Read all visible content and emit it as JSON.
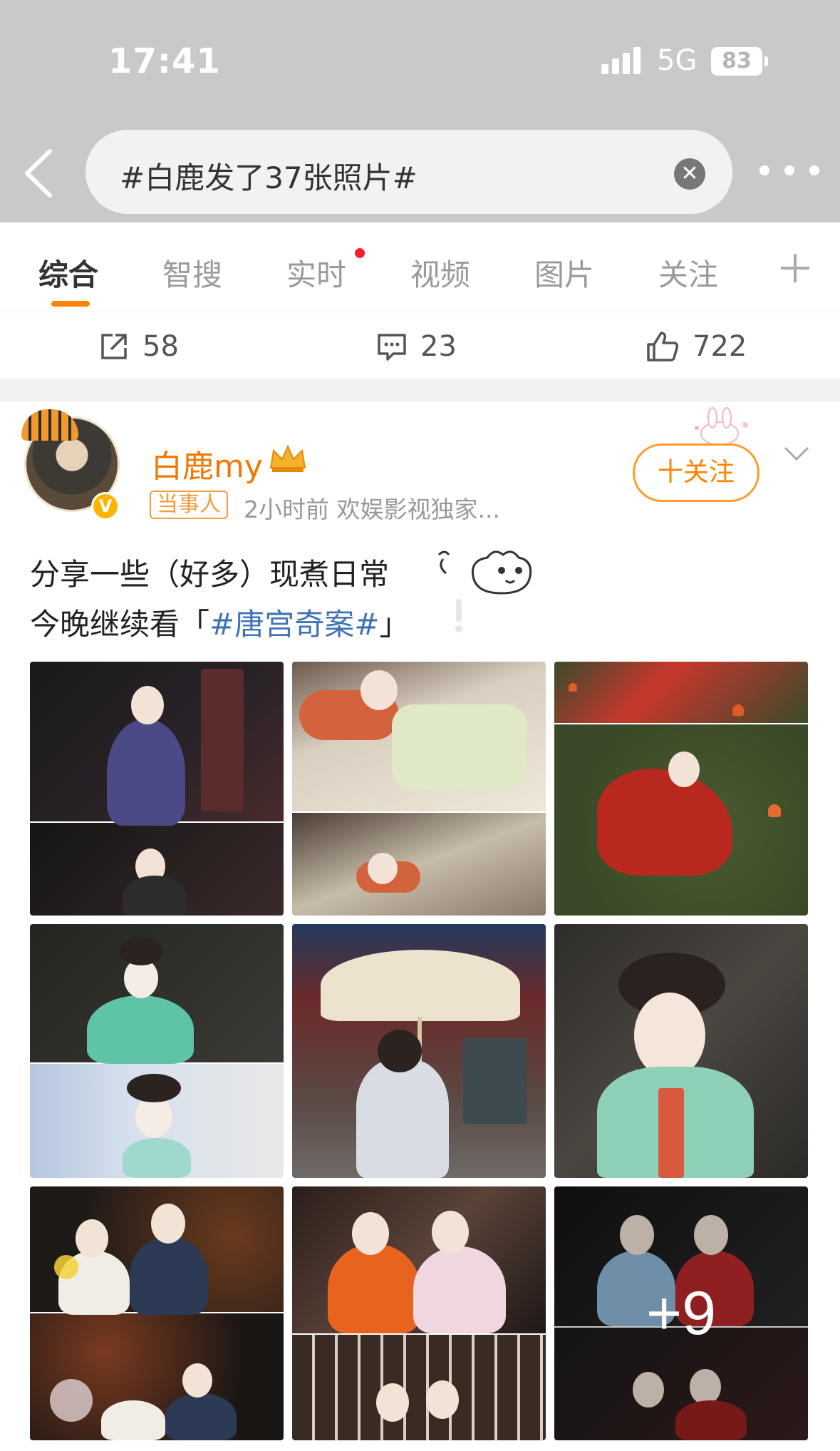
{
  "status_bar": {
    "time": "17:41",
    "network": "5G",
    "battery": "83"
  },
  "search": {
    "query": "#白鹿发了37张照片#",
    "clear_icon": "close-circle-icon",
    "more_icon": "more-dots-icon"
  },
  "tabs": [
    {
      "label": "综合",
      "active": true
    },
    {
      "label": "智搜",
      "active": false
    },
    {
      "label": "实时",
      "active": false,
      "dot": true
    },
    {
      "label": "视频",
      "active": false
    },
    {
      "label": "图片",
      "active": false
    },
    {
      "label": "关注",
      "active": false
    }
  ],
  "actions": {
    "repost": "58",
    "comment": "23",
    "like": "722"
  },
  "post": {
    "user_name": "白鹿my",
    "tag": "当事人",
    "meta": "2小时前  欢娱影视独家...",
    "follow_label": "十关注",
    "line1": "分享一些（好多）现煮日常",
    "line2_prefix": "今晚继续看「",
    "line2_hashtag": "#唐宫奇案#",
    "line2_suffix": "」",
    "more_photos": "+9"
  },
  "colors": {
    "accent": "#ff8200",
    "link": "#3f73b5",
    "username": "#f07800"
  }
}
